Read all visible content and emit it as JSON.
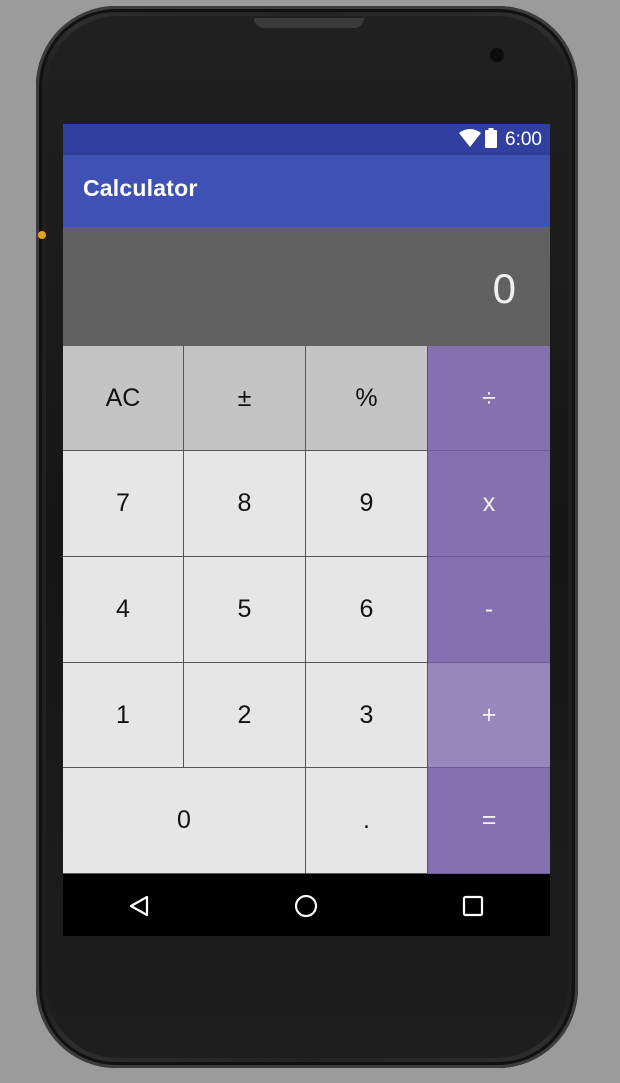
{
  "status_bar": {
    "time": "6:00",
    "icons": [
      "wifi-icon",
      "battery-icon"
    ]
  },
  "app_bar": {
    "title": "Calculator"
  },
  "display": {
    "value": "0"
  },
  "keypad": {
    "keys": [
      {
        "label": "AC",
        "type": "function"
      },
      {
        "label": "±",
        "type": "function"
      },
      {
        "label": "%",
        "type": "function"
      },
      {
        "label": "÷",
        "type": "operator"
      },
      {
        "label": "7",
        "type": "number"
      },
      {
        "label": "8",
        "type": "number"
      },
      {
        "label": "9",
        "type": "number"
      },
      {
        "label": "x",
        "type": "operator"
      },
      {
        "label": "4",
        "type": "number"
      },
      {
        "label": "5",
        "type": "number"
      },
      {
        "label": "6",
        "type": "number"
      },
      {
        "label": "-",
        "type": "operator"
      },
      {
        "label": "1",
        "type": "number"
      },
      {
        "label": "2",
        "type": "number"
      },
      {
        "label": "3",
        "type": "number"
      },
      {
        "label": "+",
        "type": "operator"
      },
      {
        "label": "0",
        "type": "number"
      },
      {
        "label": ".",
        "type": "number"
      },
      {
        "label": "=",
        "type": "operator"
      }
    ]
  },
  "nav_bar": {
    "icons": [
      "back-icon",
      "home-icon",
      "recents-icon"
    ]
  },
  "colors": {
    "status_bar": "#3140a0",
    "app_bar": "#3f51b5",
    "display_bg": "#616161",
    "function_key": "#c4c4c4",
    "number_key": "#e6e6e6",
    "operator_key": "#8471b0",
    "operator_key_pressed": "#9788bc"
  }
}
